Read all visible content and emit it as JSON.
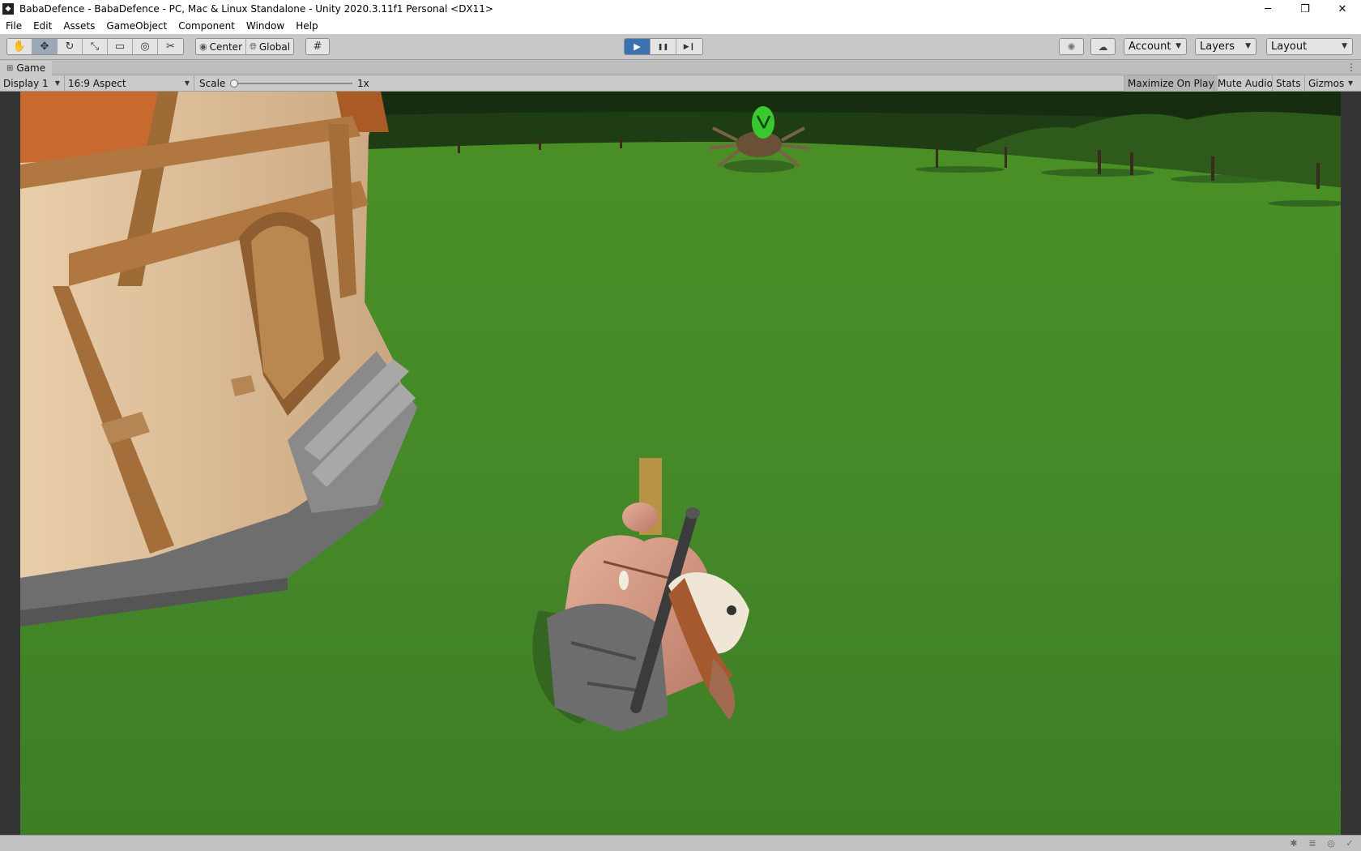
{
  "window": {
    "title": "BabaDefence - BabaDefence - PC, Mac & Linux Standalone - Unity 2020.3.11f1 Personal <DX11>",
    "minimize_icon": "minimize-icon",
    "maximize_icon": "restore-icon",
    "close_icon": "close-icon"
  },
  "menu": {
    "items": [
      "File",
      "Edit",
      "Assets",
      "GameObject",
      "Component",
      "Window",
      "Help"
    ]
  },
  "toolbar": {
    "tools": [
      {
        "name": "hand-tool",
        "icon": "✋",
        "active": false
      },
      {
        "name": "move-tool",
        "icon": "✥",
        "active": true
      },
      {
        "name": "rotate-tool",
        "icon": "↻",
        "active": false
      },
      {
        "name": "scale-tool",
        "icon": "⤡",
        "active": false
      },
      {
        "name": "rect-tool",
        "icon": "▭",
        "active": false
      },
      {
        "name": "transform-tool",
        "icon": "◎",
        "active": false
      },
      {
        "name": "custom-tool",
        "icon": "✂",
        "active": false
      }
    ],
    "pivot_label": "Center",
    "rotation_label": "Global",
    "grid_icon": "grid-snap-icon",
    "play_icon": "▶",
    "pause_icon": "❚❚",
    "step_icon": "▶❙",
    "account_label": "Account",
    "layers_label": "Layers",
    "layout_label": "Layout"
  },
  "tab": {
    "label": "Game"
  },
  "gamebar": {
    "display": "Display 1",
    "aspect": "16:9 Aspect",
    "scale_label": "Scale",
    "scale_value": "1x",
    "maximize_on_play": "Maximize On Play",
    "mute_audio": "Mute Audio",
    "stats": "Stats",
    "gizmos": "Gizmos"
  },
  "colors": {
    "ground": "#4a8a2a",
    "trees": "#1e3d14",
    "play_active": "#3a72b0"
  }
}
